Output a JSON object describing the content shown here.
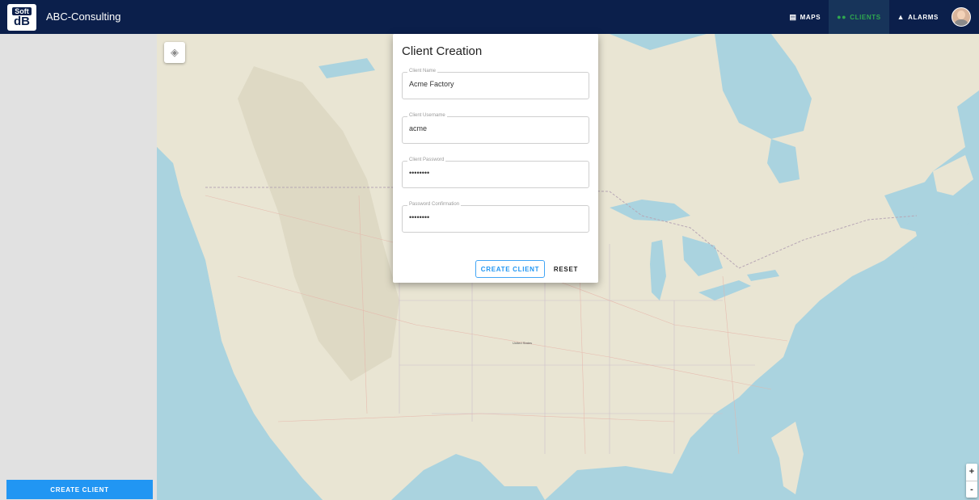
{
  "app": {
    "logo_top": "Soft",
    "logo_bottom": "dB",
    "title": "ABC-Consulting"
  },
  "nav": {
    "items": [
      {
        "icon": "map-icon",
        "label": "MAPS",
        "active": false
      },
      {
        "icon": "clients-icon",
        "label": "CLIENTS",
        "active": true
      },
      {
        "icon": "bell-icon",
        "label": "ALARMS",
        "active": false
      }
    ]
  },
  "sidebar": {
    "create_button": "CREATE CLIENT"
  },
  "dialog": {
    "title": "Client Creation",
    "fields": [
      {
        "label": "Client Name",
        "value": "Acme Factory",
        "type": "text"
      },
      {
        "label": "Client Username",
        "value": "acme",
        "type": "text"
      },
      {
        "label": "Client Password",
        "value": "••••••••",
        "type": "password"
      },
      {
        "label": "Password Confirmation",
        "value": "••••••••",
        "type": "password"
      }
    ],
    "create_button": "CREATE CLIENT",
    "reset_button": "RESET"
  },
  "map": {
    "zoom_in": "+",
    "zoom_out": "-",
    "labels": [
      "United States"
    ],
    "colors": {
      "water": "#aad3df",
      "land": "#e8e4d4",
      "topbar": "#0b1f4b",
      "accent": "#2196f3",
      "active_nav": "#2fa84f"
    }
  }
}
